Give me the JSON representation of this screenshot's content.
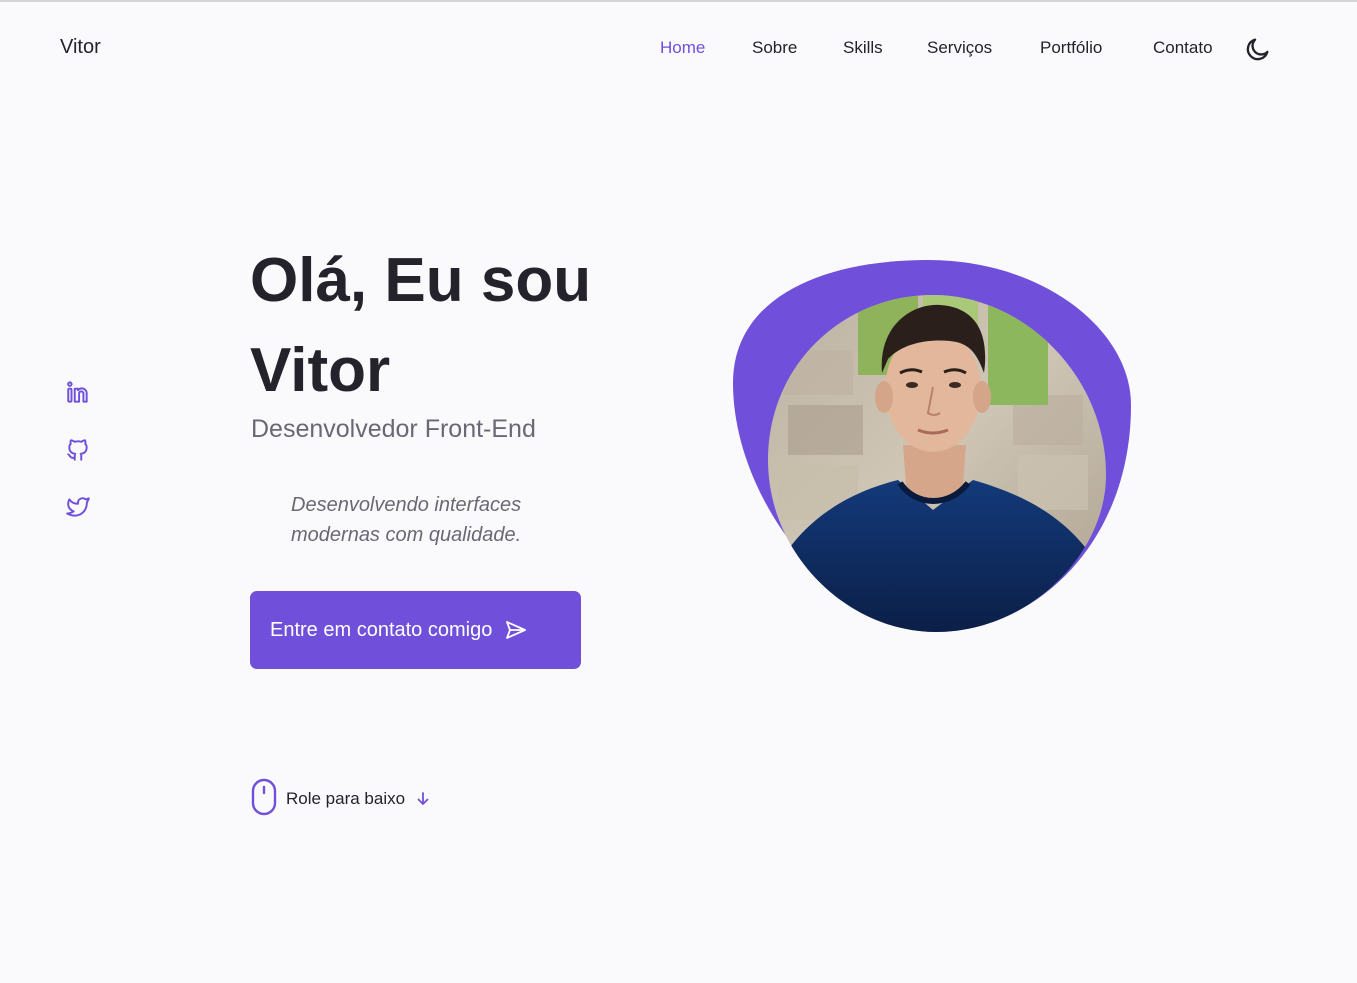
{
  "header": {
    "logo": "Vitor",
    "nav": [
      {
        "label": "Home",
        "active": true
      },
      {
        "label": "Sobre",
        "active": false
      },
      {
        "label": "Skills",
        "active": false
      },
      {
        "label": "Serviços",
        "active": false
      },
      {
        "label": "Portfólio",
        "active": false
      },
      {
        "label": "Contato",
        "active": false
      }
    ],
    "theme_toggle_icon": "moon-icon"
  },
  "social": [
    {
      "icon": "linkedin-icon"
    },
    {
      "icon": "github-icon"
    },
    {
      "icon": "twitter-icon"
    }
  ],
  "hero": {
    "title_line1": "Olá, Eu sou",
    "title_line2": "Vitor",
    "subtitle": "Desenvolvedor Front-End",
    "description": "Desenvolvendo interfaces modernas com qualidade.",
    "cta_label": "Entre em contato comigo",
    "cta_icon": "send-icon",
    "profile_image": "profile-photo"
  },
  "scroll": {
    "label": "Role para baixo",
    "mouse_icon": "mouse-icon",
    "arrow_icon": "arrow-down-icon"
  },
  "colors": {
    "accent": "#7050db",
    "text": "#24222b",
    "muted": "#6b6875",
    "background": "#fafafc"
  }
}
